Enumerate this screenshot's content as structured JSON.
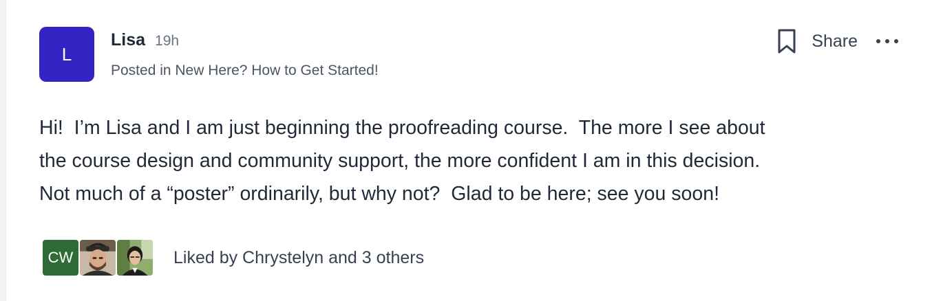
{
  "post": {
    "author": {
      "name": "Lisa",
      "initial": "L",
      "avatar_color": "#3424c4"
    },
    "time": "19h",
    "posted_in": "Posted in New Here? How to Get Started!",
    "body": "Hi!  I’m Lisa and I am just beginning the proofreading course.  The more I see about\nthe course design and community support, the more confident I am in this decision.\nNot much of a “poster” ordinarily, but why not?  Glad to be here; see you soon!",
    "actions": {
      "bookmark_icon": "bookmark-icon",
      "share_label": "Share",
      "more_icon": "more-horizontal-icon"
    },
    "likes": {
      "avatars": [
        {
          "initials": "CW",
          "color": "#2f6b35"
        },
        {
          "icon": "user-photo-icon"
        },
        {
          "icon": "user-photo-icon"
        }
      ],
      "text": "Liked by Chrystelyn and 3 others"
    }
  }
}
